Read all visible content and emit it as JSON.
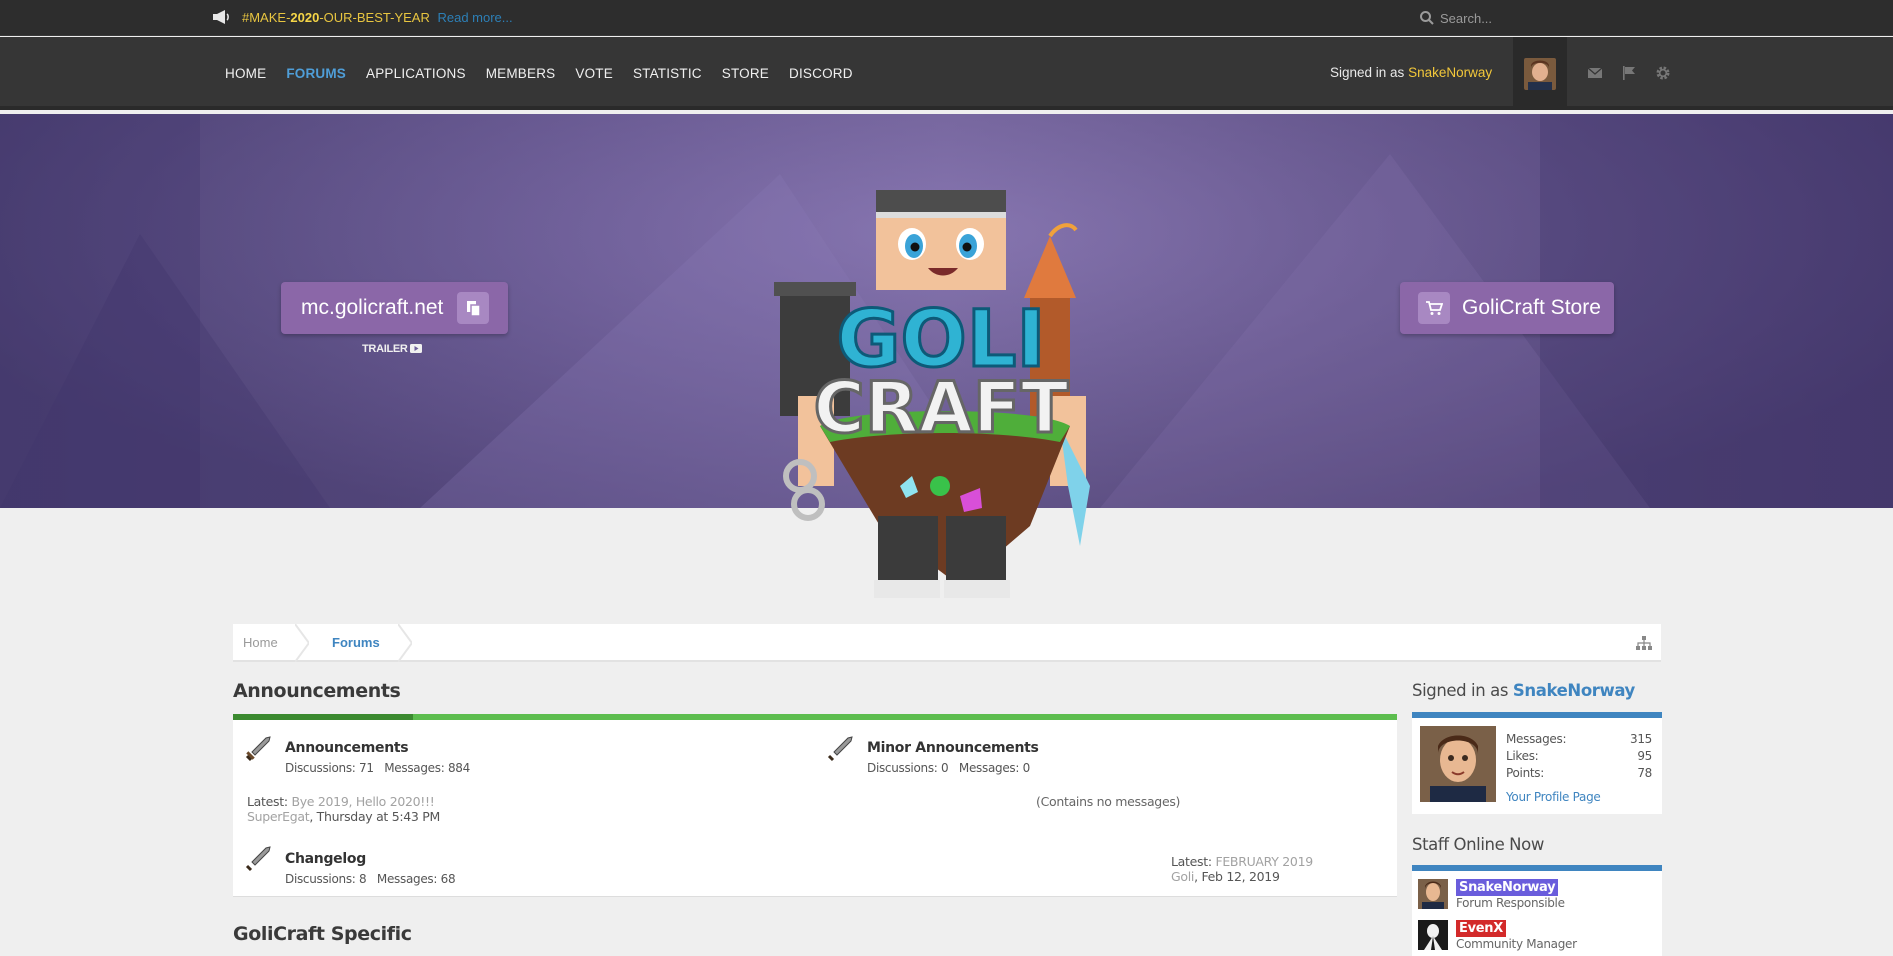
{
  "announcement": {
    "prefix": "#MAKE-",
    "year": "2020",
    "suffix": "-OUR-BEST-YEAR",
    "link": "Read more..."
  },
  "search": {
    "placeholder": "Search..."
  },
  "nav": {
    "items": [
      "HOME",
      "FORUMS",
      "APPLICATIONS",
      "MEMBERS",
      "VOTE",
      "STATISTIC",
      "STORE",
      "DISCORD"
    ],
    "active": "FORUMS"
  },
  "account": {
    "signed_prefix": "Signed in as",
    "username": "SnakeNorway"
  },
  "hero": {
    "ip_label": "mc.golicraft.net",
    "trailer_label": "TRAILER",
    "store_label": "GoliCraft Store",
    "logo_text_1": "GOLI",
    "logo_text_2": "CRAFT"
  },
  "breadcrumb": {
    "home": "Home",
    "current": "Forums"
  },
  "sections": {
    "announcements": {
      "title": "Announcements",
      "nodes": [
        {
          "title": "Announcements",
          "discussions_label": "Discussions:",
          "discussions": "71",
          "messages_label": "Messages:",
          "messages": "884",
          "latest_label": "Latest:",
          "latest_title": "Bye 2019, Hello 2020!!!",
          "latest_user": "SuperEgat",
          "latest_date": ", Thursday at 5:43 PM"
        },
        {
          "title": "Minor Announcements",
          "discussions_label": "Discussions:",
          "discussions": "0",
          "messages_label": "Messages:",
          "messages": "0",
          "empty_note": "(Contains no messages)"
        },
        {
          "title": "Changelog",
          "discussions_label": "Discussions:",
          "discussions": "8",
          "messages_label": "Messages:",
          "messages": "68",
          "latest_label": "Latest:",
          "latest_title": "FEBRUARY 2019",
          "latest_user": "Goli",
          "latest_date": ", Feb 12, 2019"
        }
      ]
    },
    "golicraft_specific": {
      "title": "GoliCraft Specific"
    }
  },
  "sidebar": {
    "signed_prefix": "Signed in as",
    "username": "SnakeNorway",
    "stats": [
      {
        "label": "Messages:",
        "value": "315"
      },
      {
        "label": "Likes:",
        "value": "95"
      },
      {
        "label": "Points:",
        "value": "78"
      }
    ],
    "profile_link": "Your Profile Page",
    "staff_title": "Staff Online Now",
    "staff": [
      {
        "name": "SnakeNorway",
        "role": "Forum Responsible",
        "color": "#6a5ddc"
      },
      {
        "name": "EvenX",
        "role": "Community Manager",
        "color": "#d32a2a"
      }
    ]
  },
  "colors": {
    "accent_blue": "#3f85c0",
    "green_bar": "#5cbd4e",
    "hero_button": "#8b67a8",
    "username_gold": "#f3c83a"
  }
}
